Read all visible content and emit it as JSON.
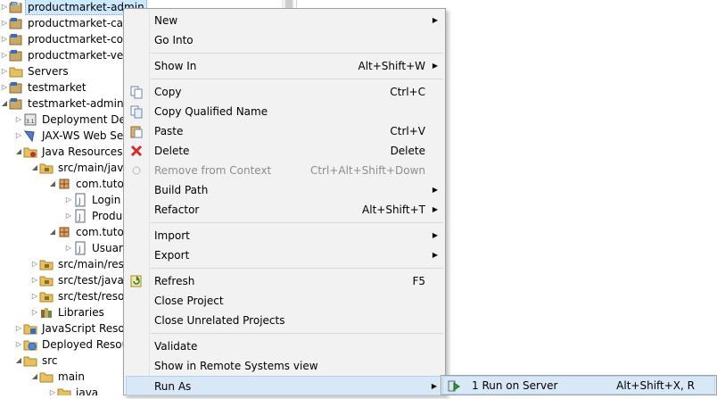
{
  "tree": {
    "items": [
      {
        "label": "productmarket-admin",
        "icon": "web-project-icon",
        "expanded": false,
        "selected": true
      },
      {
        "label": "productmarket-caja",
        "icon": "web-project-icon",
        "expanded": false
      },
      {
        "label": "productmarket-core",
        "icon": "web-project-icon",
        "expanded": false
      },
      {
        "label": "productmarket-venta",
        "icon": "web-project-icon",
        "expanded": false
      },
      {
        "label": "Servers",
        "icon": "folder-icon",
        "expanded": false
      },
      {
        "label": "testmarket",
        "icon": "web-project-icon",
        "expanded": false
      },
      {
        "label": "testmarket-admin",
        "icon": "web-project-icon",
        "expanded": true
      },
      {
        "label": "Deployment Descriptor",
        "icon": "deployment-descriptor-icon",
        "expanded": false
      },
      {
        "label": "JAX-WS Web Services",
        "icon": "jaxws-icon",
        "expanded": false
      },
      {
        "label": "Java Resources",
        "icon": "java-resources-icon",
        "expanded": true
      },
      {
        "label": "src/main/java",
        "icon": "source-folder-icon",
        "expanded": true
      },
      {
        "label": "com.tutorial",
        "icon": "package-icon",
        "expanded": true
      },
      {
        "label": "Login",
        "icon": "java-file-icon",
        "expanded": false
      },
      {
        "label": "Producto",
        "icon": "java-file-icon",
        "expanded": false
      },
      {
        "label": "com.tutorial",
        "icon": "package-icon",
        "expanded": true
      },
      {
        "label": "Usuario",
        "icon": "java-file-icon",
        "expanded": false
      },
      {
        "label": "src/main/resources",
        "icon": "source-folder-icon",
        "expanded": false
      },
      {
        "label": "src/test/java",
        "icon": "source-folder-icon",
        "expanded": false
      },
      {
        "label": "src/test/resources",
        "icon": "source-folder-icon",
        "expanded": false
      },
      {
        "label": "Libraries",
        "icon": "libraries-icon",
        "expanded": false
      },
      {
        "label": "JavaScript Resources",
        "icon": "javascript-resources-icon",
        "expanded": false
      },
      {
        "label": "Deployed Resources",
        "icon": "deployed-resources-icon",
        "expanded": false
      },
      {
        "label": "src",
        "icon": "folder-icon",
        "expanded": true
      },
      {
        "label": "main",
        "icon": "folder-icon",
        "expanded": true
      },
      {
        "label": "java",
        "icon": "folder-icon",
        "expanded": false
      }
    ]
  },
  "menu": {
    "items": [
      {
        "label": "New",
        "shortcut": "",
        "submenu": true,
        "icon": ""
      },
      {
        "label": "Go Into",
        "shortcut": "",
        "submenu": false,
        "icon": ""
      },
      {
        "label": "Show In",
        "shortcut": "Alt+Shift+W",
        "submenu": true,
        "icon": ""
      },
      {
        "label": "Copy",
        "shortcut": "Ctrl+C",
        "submenu": false,
        "icon": "copy-icon"
      },
      {
        "label": "Copy Qualified Name",
        "shortcut": "",
        "submenu": false,
        "icon": "copy-qualified-name-icon"
      },
      {
        "label": "Paste",
        "shortcut": "Ctrl+V",
        "submenu": false,
        "icon": "paste-icon"
      },
      {
        "label": "Delete",
        "shortcut": "Delete",
        "submenu": false,
        "icon": "delete-icon"
      },
      {
        "label": "Remove from Context",
        "shortcut": "Ctrl+Alt+Shift+Down",
        "submenu": false,
        "icon": "remove-context-icon",
        "disabled": true
      },
      {
        "label": "Build Path",
        "shortcut": "",
        "submenu": true,
        "icon": ""
      },
      {
        "label": "Refactor",
        "shortcut": "Alt+Shift+T",
        "submenu": true,
        "icon": ""
      },
      {
        "label": "Import",
        "shortcut": "",
        "submenu": true,
        "icon": ""
      },
      {
        "label": "Export",
        "shortcut": "",
        "submenu": true,
        "icon": ""
      },
      {
        "label": "Refresh",
        "shortcut": "F5",
        "submenu": false,
        "icon": "refresh-icon"
      },
      {
        "label": "Close Project",
        "shortcut": "",
        "submenu": false,
        "icon": ""
      },
      {
        "label": "Close Unrelated Projects",
        "shortcut": "",
        "submenu": false,
        "icon": ""
      },
      {
        "label": "Validate",
        "shortcut": "",
        "submenu": false,
        "icon": ""
      },
      {
        "label": "Show in Remote Systems view",
        "shortcut": "",
        "submenu": false,
        "icon": ""
      },
      {
        "label": "Run As",
        "shortcut": "",
        "submenu": true,
        "icon": "",
        "highlighted": true
      }
    ]
  },
  "submenu": {
    "items": [
      {
        "label": "1 Run on Server",
        "shortcut": "Alt+Shift+X, R",
        "icon": "run-on-server-icon",
        "highlighted": true
      }
    ]
  },
  "colors": {
    "selection": "#cce8ff",
    "menu_background": "#f2f2f2",
    "menu_highlight": "#d9e8f7",
    "disabled_text": "#8d8d8d"
  }
}
